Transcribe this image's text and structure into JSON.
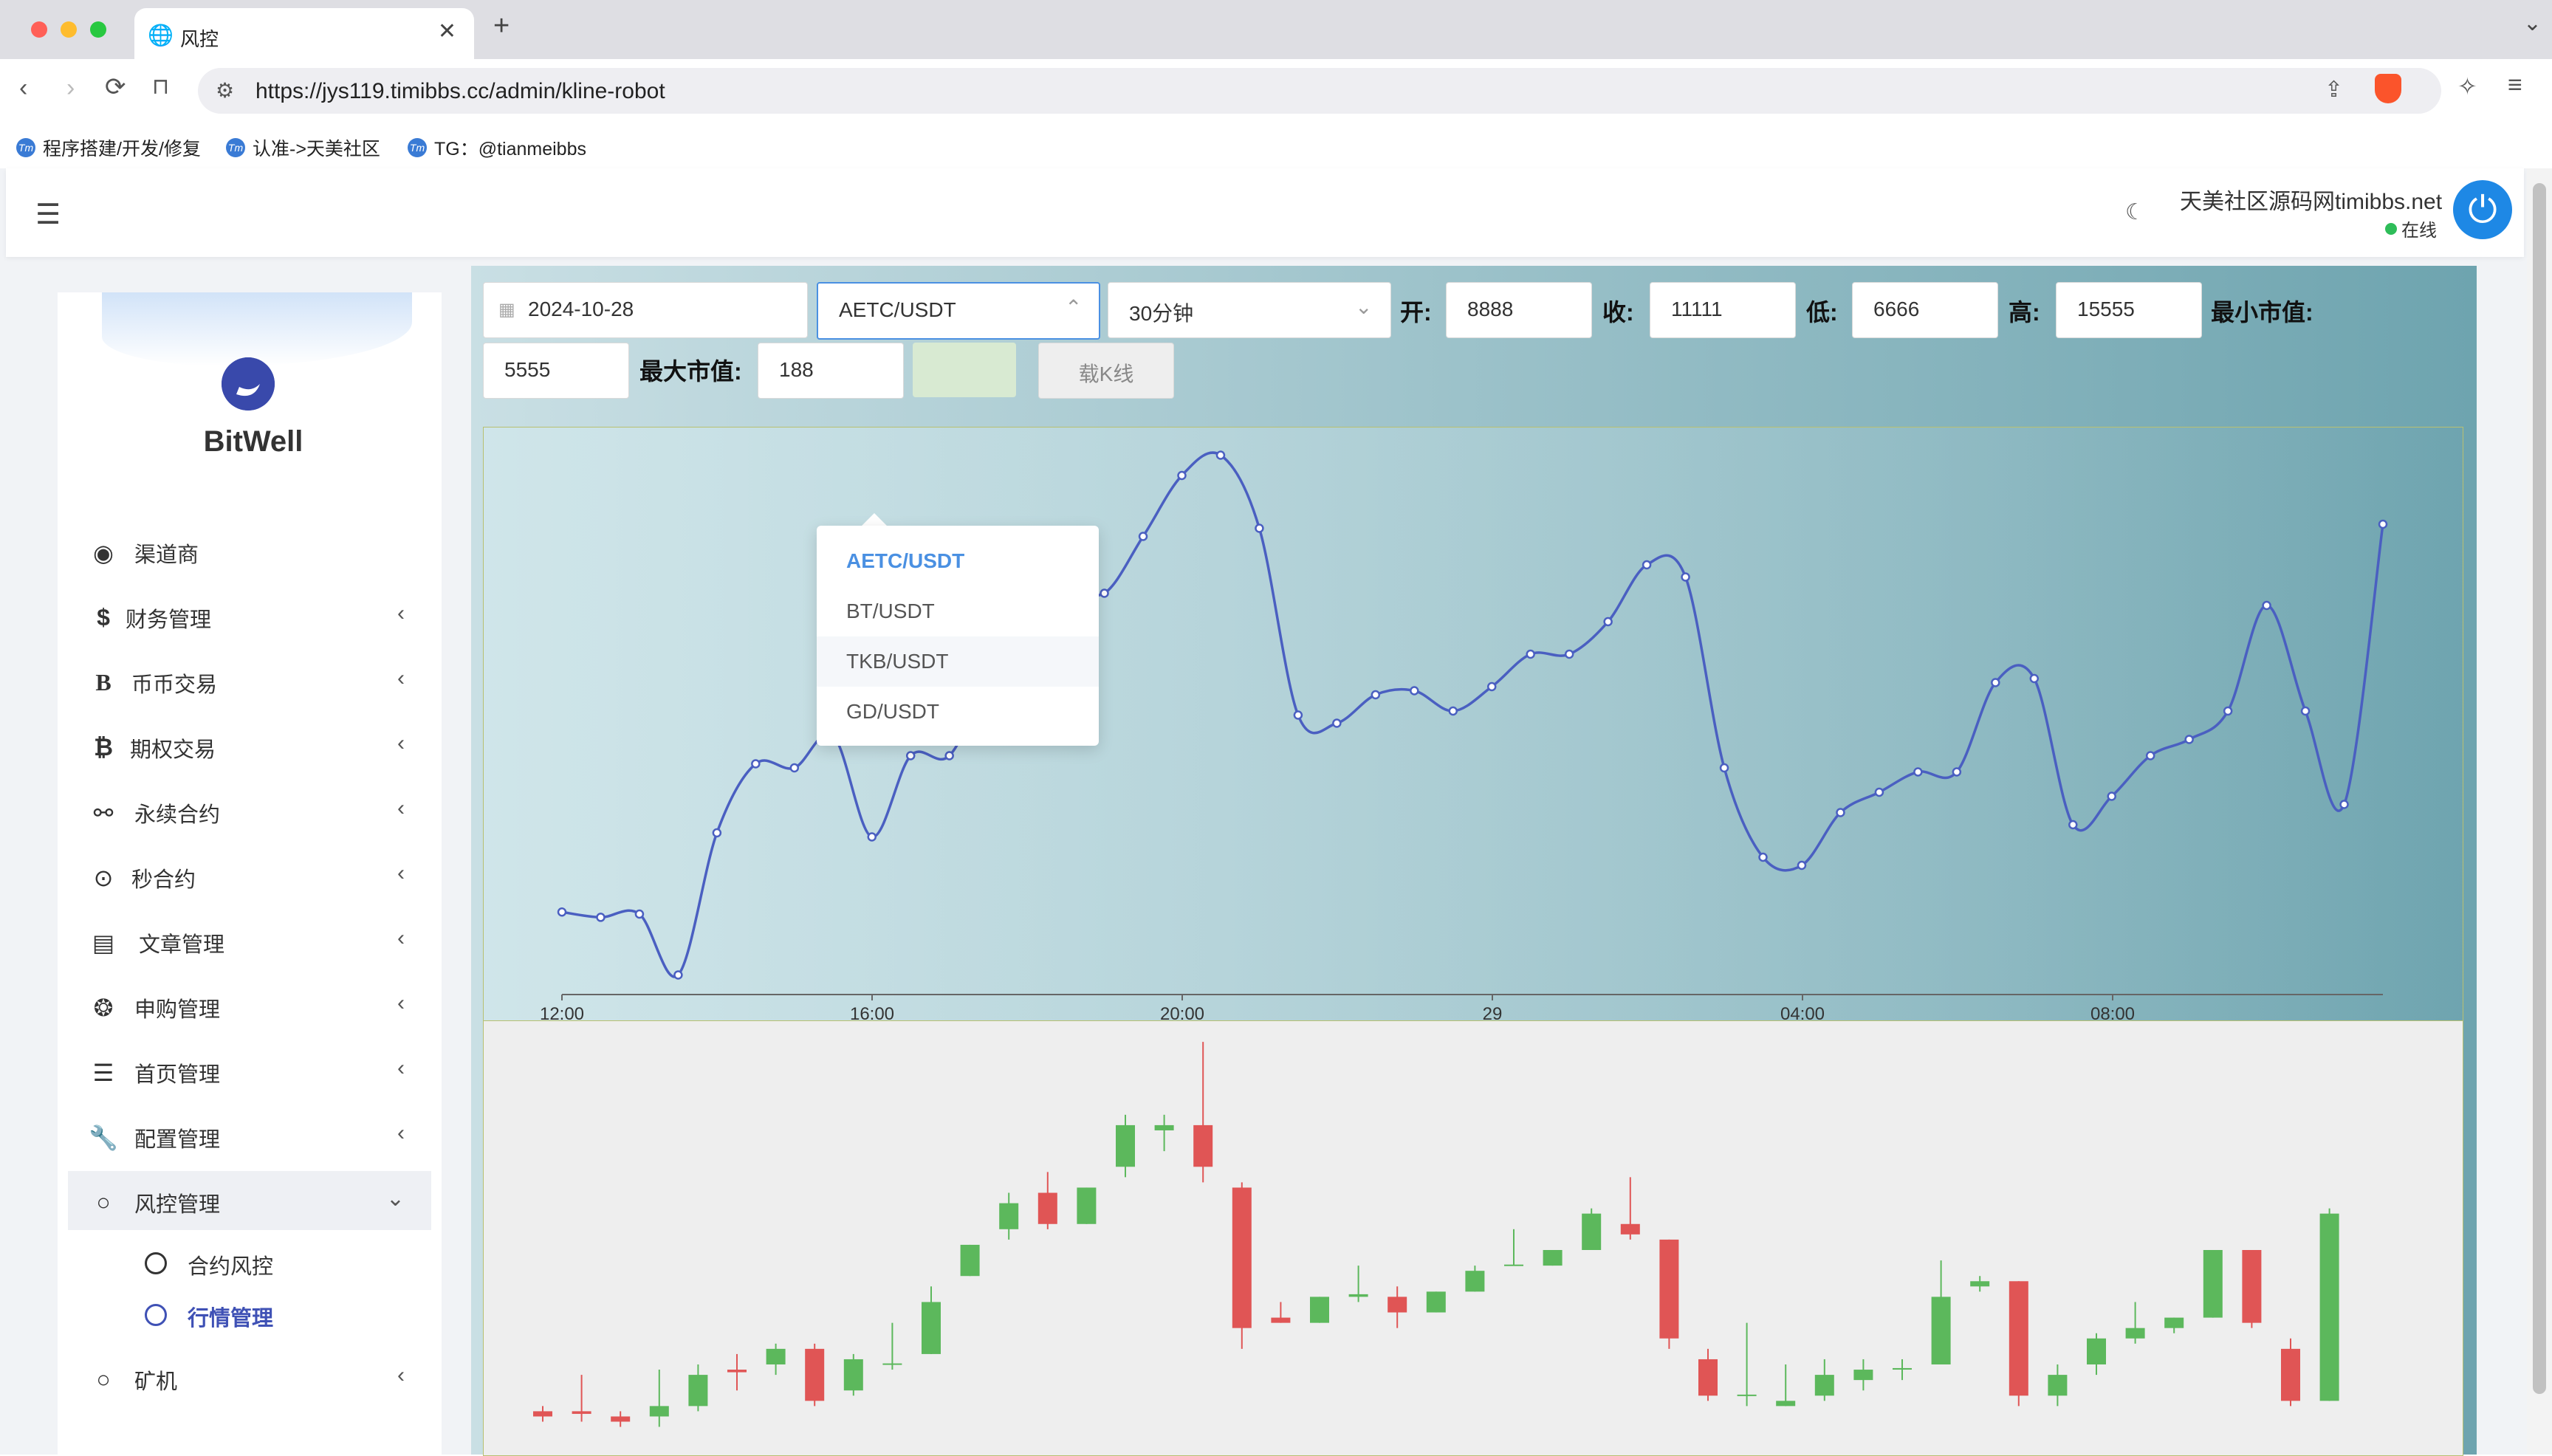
{
  "browser": {
    "tab_title": "风控",
    "url": "https://jys119.timibbs.cc/admin/kline-robot",
    "bookmarks": [
      "程序搭建/开发/修复",
      "认准->天美社区",
      "TG：@tianmeibbs"
    ],
    "bookmark_icon_text": "Tm"
  },
  "header": {
    "site_name": "天美社区源码网timibbs.net",
    "status": "在线"
  },
  "sidebar": {
    "logo_text": "BitWell",
    "items": [
      {
        "label": "渠道商",
        "icon": "user-circle-icon"
      },
      {
        "label": "财务管理",
        "icon": "dollar-icon"
      },
      {
        "label": "币币交易",
        "icon": "b-letter-icon"
      },
      {
        "label": "期权交易",
        "icon": "bitcoin-icon"
      },
      {
        "label": "永续合约",
        "icon": "link-icon"
      },
      {
        "label": "秒合约",
        "icon": "dot-circle-icon"
      },
      {
        "label": "文章管理",
        "icon": "newspaper-icon"
      },
      {
        "label": "申购管理",
        "icon": "lifebuoy-icon"
      },
      {
        "label": "首页管理",
        "icon": "list-icon"
      },
      {
        "label": "配置管理",
        "icon": "wrench-icon"
      },
      {
        "label": "风控管理",
        "icon": "circle-icon"
      },
      {
        "label": "矿机",
        "icon": "circle-icon"
      }
    ],
    "sub_items": [
      "合约风控",
      "行情管理"
    ]
  },
  "form": {
    "date": "2024-10-28",
    "pair": "AETC/USDT",
    "interval": "30分钟",
    "open_label": "开:",
    "open": "8888",
    "close_label": "收:",
    "close": "11111",
    "low_label": "低:",
    "low": "6666",
    "high_label": "高:",
    "high": "15555",
    "min_cap_label": "最小市值:",
    "min_cap": "5555",
    "max_cap_label": "最大市值:",
    "max_cap": "188",
    "load_button": "载K线"
  },
  "dropdown": {
    "options": [
      "AETC/USDT",
      "BT/USDT",
      "TKB/USDT",
      "GD/USDT"
    ],
    "selected": "AETC/USDT",
    "hovered": "TKB/USDT"
  },
  "colors": {
    "accent": "#1e88e5",
    "line": "#4a5fc1",
    "up": "#5cb85c",
    "down": "#e05555",
    "online": "#2ebd59"
  },
  "chart_data": [
    {
      "type": "line",
      "x_tick_labels": [
        "12:00",
        "16:00",
        "20:00",
        "29",
        "04:00",
        "08:00"
      ],
      "values": [
        12.5,
        11.2,
        12.0,
        -3.0,
        32.0,
        49.0,
        48.0,
        56.0,
        31.0,
        51.0,
        51.0,
        70.0,
        85.0,
        93.0,
        91.0,
        105.0,
        120.0,
        125.0,
        107.0,
        61.0,
        59.0,
        66.0,
        67.0,
        62.0,
        68.0,
        76.0,
        76.0,
        84.0,
        98.0,
        95.0,
        48.0,
        26.0,
        24.0,
        37.0,
        42.0,
        47.0,
        47.0,
        69.0,
        70.0,
        34.0,
        41.0,
        51.0,
        55.0,
        62.0,
        88.0,
        62.0,
        39.0,
        108.0
      ]
    },
    {
      "type": "candlestick",
      "candles": [
        {
          "o": 1.0,
          "c": 0.0,
          "h": 2.0,
          "l": -1.0
        },
        {
          "o": 1.0,
          "c": 0.5,
          "h": 8.0,
          "l": -1.0
        },
        {
          "o": 0.0,
          "c": -1.0,
          "h": 1.0,
          "l": -2.0
        },
        {
          "o": 0.0,
          "c": 2.0,
          "h": 9.0,
          "l": -2.0
        },
        {
          "o": 2.0,
          "c": 8.0,
          "h": 10.0,
          "l": 1.0
        },
        {
          "o": 9.0,
          "c": 8.5,
          "h": 12.0,
          "l": 5.0
        },
        {
          "o": 10.0,
          "c": 13.0,
          "h": 14.0,
          "l": 8.0
        },
        {
          "o": 13.0,
          "c": 3.0,
          "h": 14.0,
          "l": 2.0
        },
        {
          "o": 5.0,
          "c": 11.0,
          "h": 12.0,
          "l": 4.0
        },
        {
          "o": 10.0,
          "c": 10.2,
          "h": 18.0,
          "l": 9.0
        },
        {
          "o": 12.0,
          "c": 22.0,
          "h": 25.0,
          "l": 12.0
        },
        {
          "o": 27.0,
          "c": 33.0,
          "h": 33.0,
          "l": 27.0
        },
        {
          "o": 36.0,
          "c": 41.0,
          "h": 43.0,
          "l": 34.0
        },
        {
          "o": 43.0,
          "c": 37.0,
          "h": 47.0,
          "l": 36.0
        },
        {
          "o": 37.0,
          "c": 44.0,
          "h": 44.0,
          "l": 37.0
        },
        {
          "o": 48.0,
          "c": 56.0,
          "h": 58.0,
          "l": 46.0
        },
        {
          "o": 55.0,
          "c": 56.0,
          "h": 58.0,
          "l": 51.0
        },
        {
          "o": 56.0,
          "c": 48.0,
          "h": 72.0,
          "l": 45.0
        },
        {
          "o": 44.0,
          "c": 17.0,
          "h": 45.0,
          "l": 13.0
        },
        {
          "o": 19.0,
          "c": 18.0,
          "h": 22.0,
          "l": 18.0
        },
        {
          "o": 18.0,
          "c": 23.0,
          "h": 23.0,
          "l": 18.0
        },
        {
          "o": 23.0,
          "c": 23.5,
          "h": 29.0,
          "l": 22.0
        },
        {
          "o": 23.0,
          "c": 20.0,
          "h": 25.0,
          "l": 17.0
        },
        {
          "o": 20.0,
          "c": 24.0,
          "h": 24.0,
          "l": 20.0
        },
        {
          "o": 24.0,
          "c": 28.0,
          "h": 29.0,
          "l": 24.0
        },
        {
          "o": 29.0,
          "c": 29.2,
          "h": 36.0,
          "l": 29.0
        },
        {
          "o": 29.0,
          "c": 32.0,
          "h": 32.0,
          "l": 29.0
        },
        {
          "o": 32.0,
          "c": 39.0,
          "h": 40.0,
          "l": 32.0
        },
        {
          "o": 37.0,
          "c": 35.0,
          "h": 46.0,
          "l": 34.0
        },
        {
          "o": 34.0,
          "c": 15.0,
          "h": 34.0,
          "l": 13.0
        },
        {
          "o": 11.0,
          "c": 4.0,
          "h": 13.0,
          "l": 3.0
        },
        {
          "o": 4.0,
          "c": 4.2,
          "h": 18.0,
          "l": 2.0
        },
        {
          "o": 2.0,
          "c": 3.0,
          "h": 10.0,
          "l": 2.0
        },
        {
          "o": 4.0,
          "c": 8.0,
          "h": 11.0,
          "l": 3.0
        },
        {
          "o": 7.0,
          "c": 9.0,
          "h": 11.0,
          "l": 5.0
        },
        {
          "o": 9.0,
          "c": 9.3,
          "h": 11.0,
          "l": 7.0
        },
        {
          "o": 10.0,
          "c": 23.0,
          "h": 30.0,
          "l": 10.0
        },
        {
          "o": 25.0,
          "c": 26.0,
          "h": 27.0,
          "l": 24.0
        },
        {
          "o": 26.0,
          "c": 4.0,
          "h": 26.0,
          "l": 2.0
        },
        {
          "o": 4.0,
          "c": 8.0,
          "h": 10.0,
          "l": 2.0
        },
        {
          "o": 10.0,
          "c": 15.0,
          "h": 16.0,
          "l": 8.0
        },
        {
          "o": 15.0,
          "c": 17.0,
          "h": 22.0,
          "l": 14.0
        },
        {
          "o": 17.0,
          "c": 19.0,
          "h": 19.0,
          "l": 16.0
        },
        {
          "o": 19.0,
          "c": 32.0,
          "h": 32.0,
          "l": 19.0
        },
        {
          "o": 32.0,
          "c": 18.0,
          "h": 32.0,
          "l": 17.0
        },
        {
          "o": 13.0,
          "c": 3.0,
          "h": 15.0,
          "l": 2.0
        },
        {
          "o": 3.0,
          "c": 39.0,
          "h": 40.0,
          "l": 3.0
        }
      ]
    }
  ]
}
